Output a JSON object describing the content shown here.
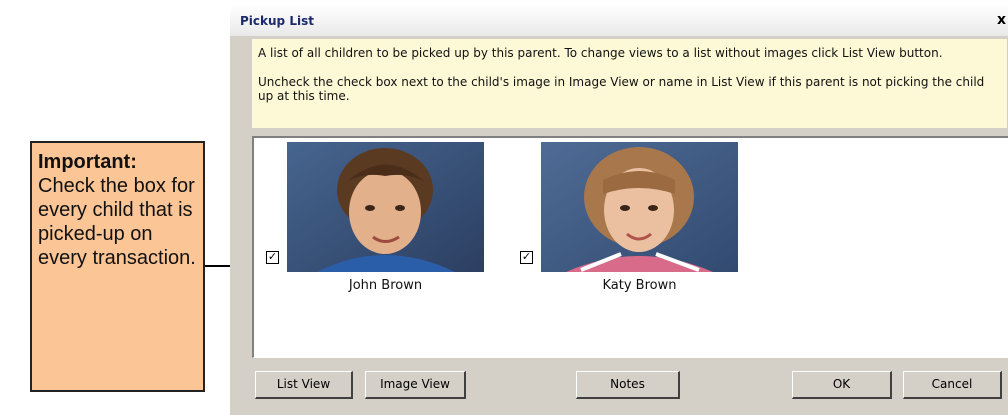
{
  "dialog": {
    "title": "Pickup List",
    "close_symbol": "x",
    "info_line1": "A list of all children to be picked up by this parent. To change views to a list without images click List View button.",
    "info_line2": "Uncheck the check box next to the child's image in Image View or name in List View if this parent is not picking the child up at this time."
  },
  "children": [
    {
      "name": "John Brown",
      "checked": true,
      "checkmark": "✓"
    },
    {
      "name": "Katy Brown",
      "checked": true,
      "checkmark": "✓"
    }
  ],
  "buttons": {
    "list_view": "List View",
    "image_view": "Image View",
    "notes": "Notes",
    "ok": "OK",
    "cancel": "Cancel"
  },
  "callout": {
    "heading": "Important:",
    "text": "Check the box for every child that is picked-up on every transaction."
  },
  "colors": {
    "callout_bg": "#fbc596",
    "info_bg": "#fdf9d6",
    "dialog_bg": "#d4d0c8",
    "title_text": "#1c2a6b"
  }
}
